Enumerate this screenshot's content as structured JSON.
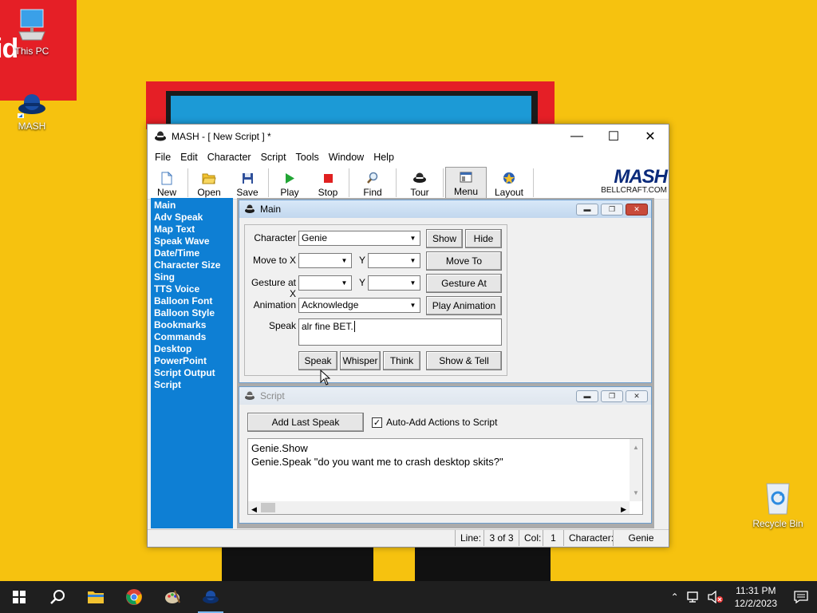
{
  "desktop": {
    "bg_text": "id",
    "icons": [
      {
        "label": "This PC"
      },
      {
        "label": "MASH"
      },
      {
        "label": "Recycle Bin"
      }
    ]
  },
  "window": {
    "title": "MASH - [ New Script ] *",
    "menu": [
      "File",
      "Edit",
      "Character",
      "Script",
      "Tools",
      "Window",
      "Help"
    ],
    "toolbar": [
      "New",
      "Open",
      "Save",
      "Play",
      "Stop",
      "Find",
      "Tour",
      "Menu",
      "Layout"
    ],
    "logo": {
      "big": "MASH",
      "small": "BELLCRAFT.COM"
    }
  },
  "sidebar": {
    "items": [
      "Main",
      "Adv Speak",
      "Map Text",
      "Speak Wave",
      "Date/Time",
      "Character Size",
      "Sing",
      "TTS Voice",
      "Balloon Font",
      "Balloon Style",
      "Bookmarks",
      "Commands",
      "Desktop",
      "PowerPoint",
      "Script Output",
      "Script"
    ]
  },
  "main_panel": {
    "title": "Main",
    "character_label": "Character",
    "character_value": "Genie",
    "show_label": "Show",
    "hide_label": "Hide",
    "move_to_x_label": "Move to X",
    "move_y_label": "Y",
    "move_to_button": "Move To",
    "gesture_x_label": "Gesture at X",
    "gesture_y_label": "Y",
    "gesture_button": "Gesture At",
    "animation_label": "Animation",
    "animation_value": "Acknowledge",
    "play_animation_button": "Play Animation",
    "speak_label": "Speak",
    "speak_text": "alr fine BET.",
    "buttons": {
      "speak": "Speak",
      "whisper": "Whisper",
      "think": "Think",
      "show_tell": "Show & Tell"
    }
  },
  "script_panel": {
    "title": "Script",
    "add_last_speak": "Add Last Speak",
    "auto_add_label": "Auto-Add Actions to Script",
    "auto_add_checked": true,
    "lines": [
      "Genie.Show",
      "Genie.Speak \"do you want me to crash desktop skits?\""
    ]
  },
  "statusbar": {
    "line_label": "Line:",
    "line_value": "3 of 3",
    "col_label": "Col:",
    "col_value": "1",
    "character_label": "Character:",
    "character_value": "Genie"
  },
  "taskbar": {
    "time": "11:31 PM",
    "date": "12/2/2023"
  }
}
